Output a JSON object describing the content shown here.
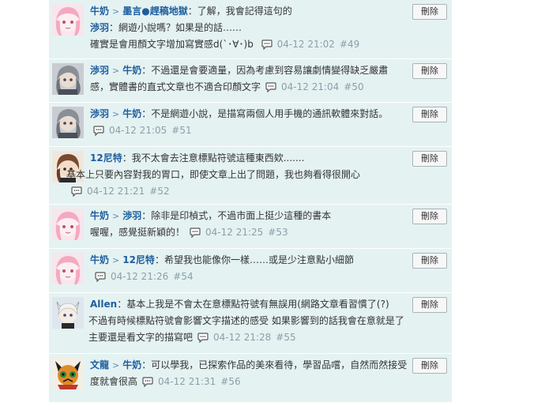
{
  "delete_label": "刪除",
  "replies": [
    {
      "users": [
        "牛奶",
        "墨言●趕稿地獄"
      ],
      "body_lines": [
        "：了解，我會記得這句的"
      ],
      "extra_users": [
        "渉羽"
      ],
      "extra_body": "：網遊小說嗎？如果是的話……",
      "tail_text": "確實是會用顏文字增加寫實感d(`･∀･)b",
      "time": "04-12 21:02",
      "floor": "#49"
    },
    {
      "users": [
        "渉羽",
        "牛奶"
      ],
      "body": "：不過還是會要適量，因為考慮到容易讓劇情變得缺乏嚴肅感，實體書的直式文章也不適合印顏文字",
      "time": "04-12 21:04",
      "floor": "#50"
    },
    {
      "users": [
        "渉羽",
        "牛奶"
      ],
      "body": "：不是網遊小說，是描寫兩個人用手機的通訊軟體來對話。",
      "time": "04-12 21:05",
      "floor": "#51"
    },
    {
      "users": [
        "12尼特"
      ],
      "body": "：我不太會去注意標點符號這種東西欸.......",
      "body2": "基本上只要內容對我的胃口，即使文章上出了問題，我也夠看得很開心",
      "time": "04-12 21:21",
      "floor": "#52"
    },
    {
      "users": [
        "牛奶",
        "渉羽"
      ],
      "body": "：除非是印楨式，不過市面上挺少這種的書本",
      "body2": "喔喔，感覺挺新穎的！",
      "time": "04-12 21:25",
      "floor": "#53"
    },
    {
      "users": [
        "牛奶",
        "12尼特"
      ],
      "body": "：希望我也能像你一樣……或是少注意點小細節",
      "time": "04-12 21:26",
      "floor": "#54"
    },
    {
      "users": [
        "Allen"
      ],
      "body": "：基本上我是不會太在意標點符號有無誤用(網路文章看習慣了(?)",
      "body2": "不過有時候標點符號會影響文字描述的感受 如果影響到的話我會在意就是了",
      "body3": "主要還是看文字的描寫吧",
      "time": "04-12 21:28",
      "floor": "#55"
    },
    {
      "users": [
        "文龍",
        "牛奶"
      ],
      "body": "：可以學我，已探索作品的美來看待，學習品嚐，自然而然接受度就會很高",
      "time": "04-12 21:31",
      "floor": "#56"
    }
  ]
}
